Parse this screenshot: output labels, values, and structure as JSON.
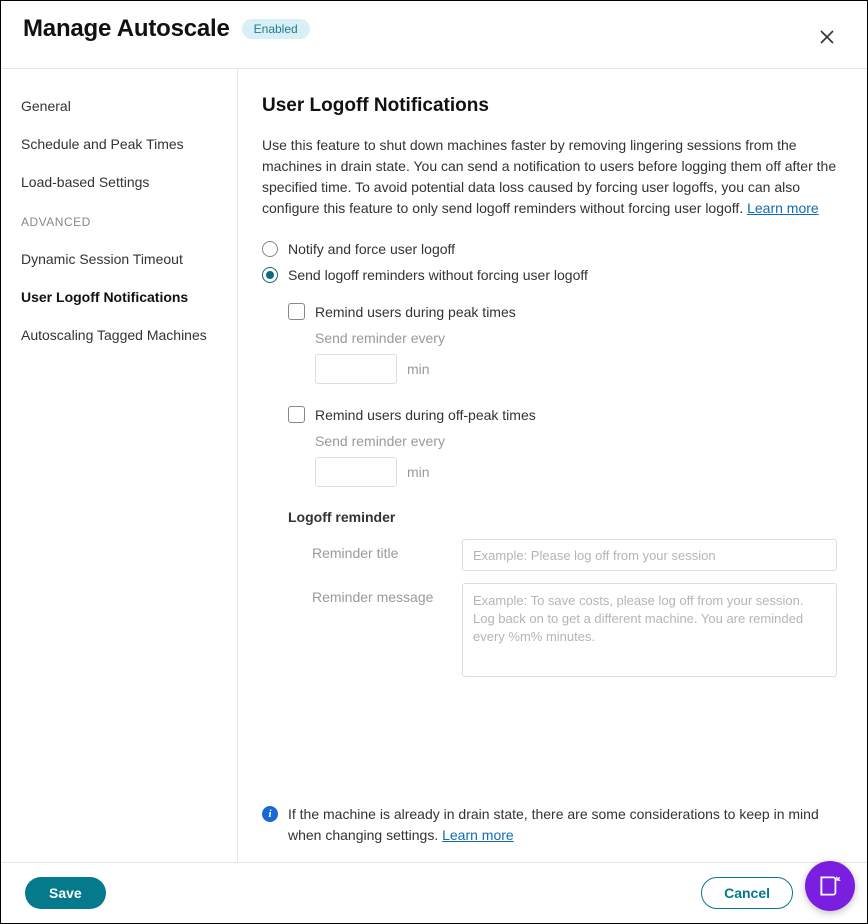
{
  "header": {
    "title": "Manage Autoscale",
    "badge": "Enabled"
  },
  "sidebar": {
    "items": [
      {
        "label": "General",
        "type": "item"
      },
      {
        "label": "Schedule and Peak Times",
        "type": "item"
      },
      {
        "label": "Load-based Settings",
        "type": "item"
      },
      {
        "label": "ADVANCED",
        "type": "section"
      },
      {
        "label": "Dynamic Session Timeout",
        "type": "item"
      },
      {
        "label": "User Logoff Notifications",
        "type": "item",
        "active": true
      },
      {
        "label": "Autoscaling Tagged Machines",
        "type": "item"
      }
    ]
  },
  "content": {
    "title": "User Logoff Notifications",
    "description": "Use this feature to shut down machines faster by removing lingering sessions from the machines in drain state. You can send a notification to users before logging them off after the specified time. To avoid potential data loss caused by forcing user logoffs, you can also configure this feature to only send logoff reminders without forcing user logoff. ",
    "learn_more": "Learn more",
    "radio": {
      "notify_force": "Notify and force user logoff",
      "send_reminders": "Send logoff reminders without forcing user logoff",
      "selected": "send_reminders"
    },
    "peak": {
      "label": "Remind users during peak times",
      "sublabel": "Send reminder every",
      "unit": "min",
      "value": ""
    },
    "offpeak": {
      "label": "Remind users during off-peak times",
      "sublabel": "Send reminder every",
      "unit": "min",
      "value": ""
    },
    "reminder_section": "Logoff reminder",
    "reminder_title": {
      "label": "Reminder title",
      "placeholder": "Example: Please log off from your session",
      "value": ""
    },
    "reminder_message": {
      "label": "Reminder message",
      "placeholder": "Example: To save costs, please log off from your session. Log back on to get a different machine. You are reminded every %m% minutes.",
      "value": ""
    },
    "info": {
      "text": "If the machine is already in drain state, there are some considerations to keep in mind when changing settings. ",
      "link": "Learn more"
    }
  },
  "footer": {
    "save": "Save",
    "cancel": "Cancel"
  },
  "icons": {
    "close": "close-icon",
    "info": "info-icon",
    "help": "help-docs-icon"
  }
}
